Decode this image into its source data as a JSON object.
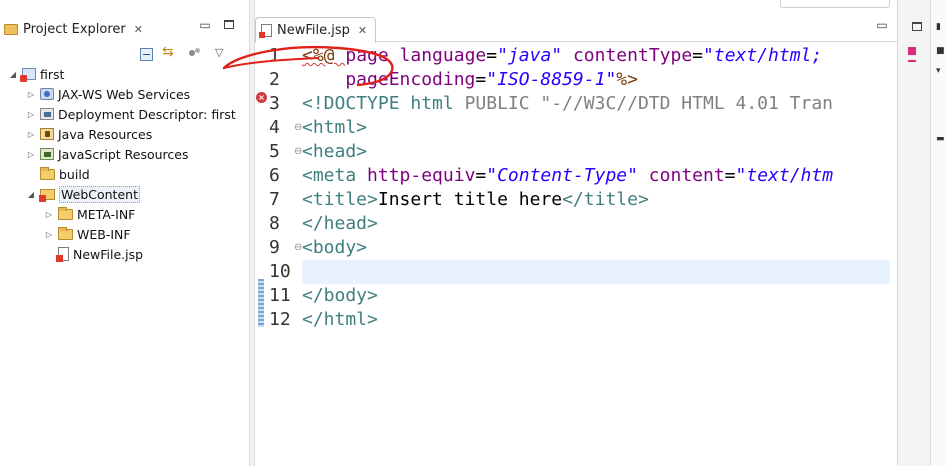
{
  "explorer": {
    "tab_label": "Project Explorer",
    "tab_close": "✕",
    "minimize": "▭",
    "tree": [
      {
        "label": "first",
        "icon": "project-icon",
        "twisty": "◢",
        "indent": 0
      },
      {
        "label": "JAX-WS Web Services",
        "icon": "jaxws-icon",
        "twisty": "▷",
        "indent": 1
      },
      {
        "label": "Deployment Descriptor: first",
        "icon": "deployment-descriptor-icon",
        "twisty": "▷",
        "indent": 1
      },
      {
        "label": "Java Resources",
        "icon": "java-resources-icon",
        "twisty": "▷",
        "indent": 1
      },
      {
        "label": "JavaScript Resources",
        "icon": "javascript-resources-icon",
        "twisty": "▷",
        "indent": 1
      },
      {
        "label": "build",
        "icon": "folder-icon",
        "twisty": "",
        "indent": 1
      },
      {
        "label": "WebContent",
        "icon": "webcontent-folder-icon",
        "twisty": "◢",
        "indent": 1
      },
      {
        "label": "META-INF",
        "icon": "folder-icon",
        "twisty": "▷",
        "indent": 2
      },
      {
        "label": "WEB-INF",
        "icon": "folder-icon",
        "twisty": "▷",
        "indent": 2
      },
      {
        "label": "NewFile.jsp",
        "icon": "jsp-file-icon",
        "twisty": "",
        "indent": 2
      }
    ]
  },
  "editor": {
    "tab_label": "NewFile.jsp",
    "tab_close": "✕",
    "line_numbers": [
      "1",
      "2",
      "3",
      "4",
      "5",
      "6",
      "7",
      "8",
      "9",
      "10",
      "11",
      "12"
    ],
    "code": {
      "l1": {
        "a": "<%@ ",
        "b": "page ",
        "c": "language",
        "d": "=",
        "e": "\"java\"",
        "f": " contentType",
        "g": "=",
        "h": "\"text/html;"
      },
      "l2": {
        "a": "    pageEncoding",
        "b": "=",
        "c": "\"ISO-8859-1\"",
        "d": "%>"
      },
      "l3": {
        "a": "<!DOCTYPE ",
        "b": "html ",
        "c": "PUBLIC ",
        "d": "\"-//W3C//DTD HTML 4.01 Tran"
      },
      "l4": "<html>",
      "l5": "<head>",
      "l6": {
        "a": "<meta ",
        "b": "http-equiv",
        "c": "=",
        "d": "\"Content-Type\"",
        "e": " content",
        "f": "=",
        "g": "\"text/htm"
      },
      "l7": {
        "a": "<title>",
        "b": "Insert title here",
        "c": "</title>"
      },
      "l8": "</head>",
      "l9": "<body>",
      "l10": "",
      "l11": "</body>",
      "l12": "</html>"
    }
  },
  "colors": {
    "directive": "#7d3a0a",
    "attribute": "#7f007f",
    "string": "#2a00ff",
    "tag": "#3f7f7f",
    "error_marker": "#d13b3b",
    "annotation": "#e0211a",
    "current_line": "#e8f2fe"
  }
}
